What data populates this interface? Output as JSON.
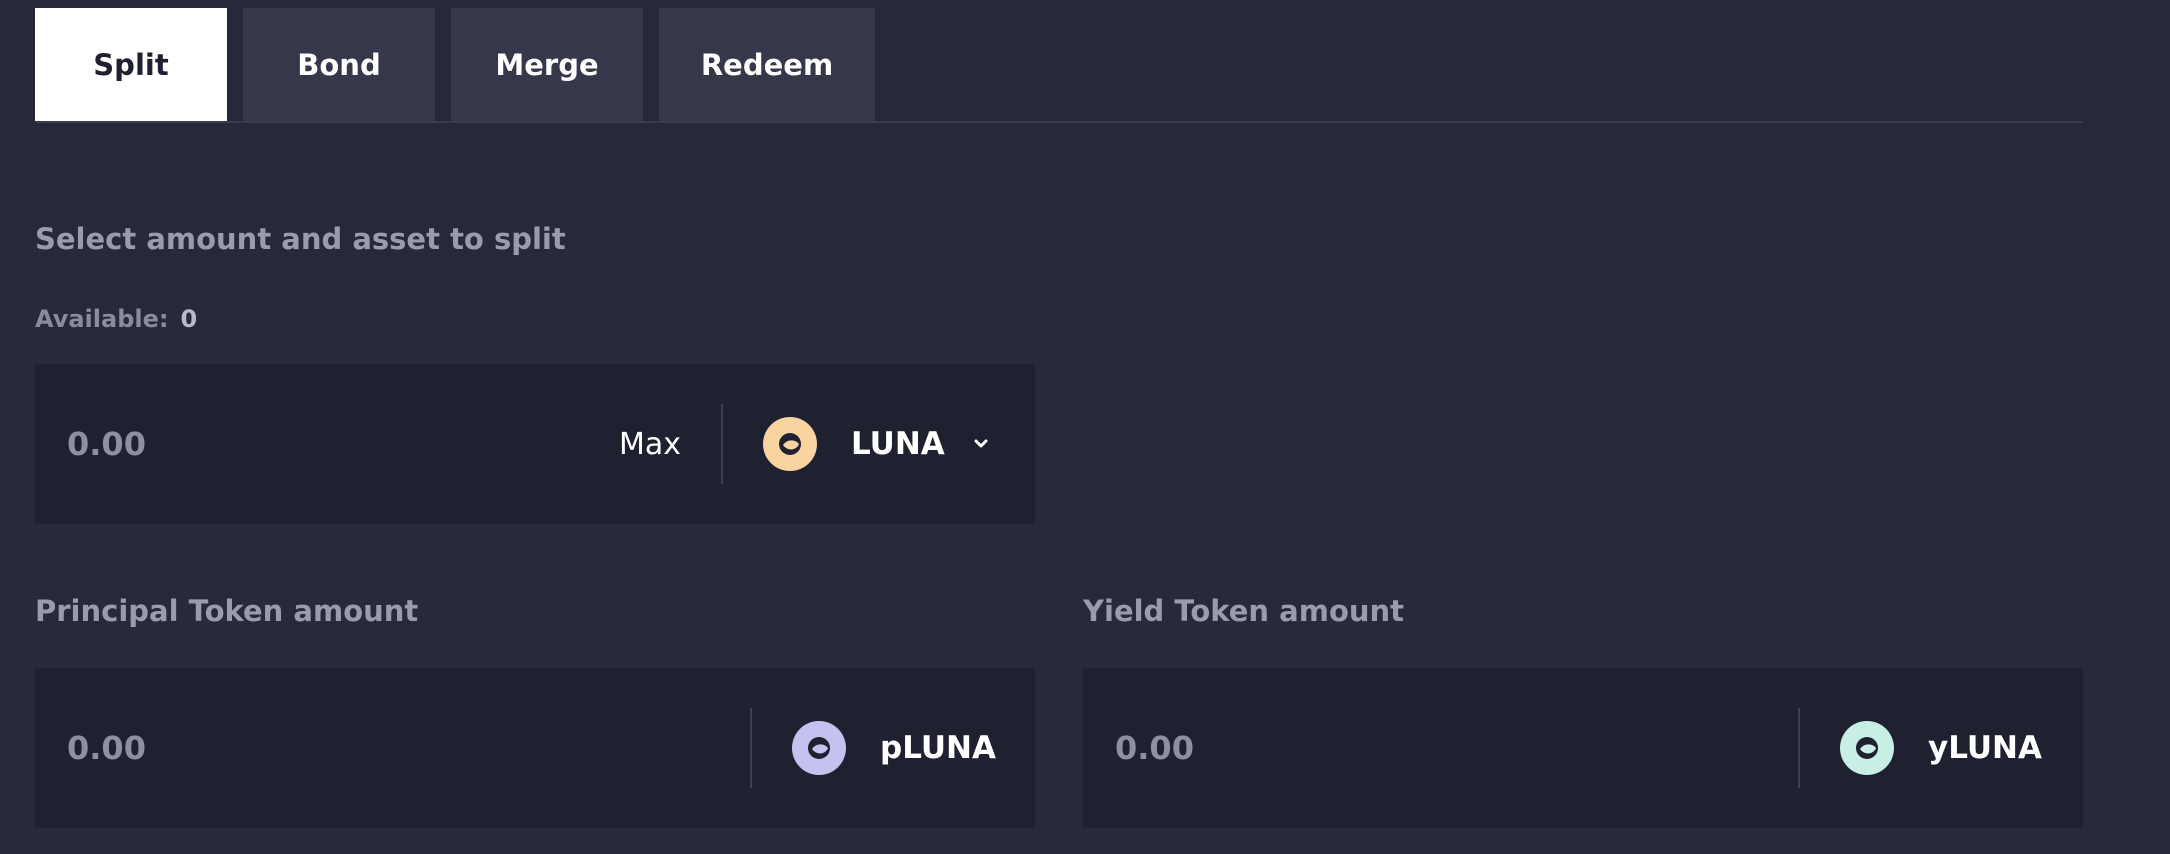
{
  "tabs": [
    {
      "label": "Split",
      "active": true
    },
    {
      "label": "Bond",
      "active": false
    },
    {
      "label": "Merge",
      "active": false
    },
    {
      "label": "Redeem",
      "active": false
    }
  ],
  "split": {
    "title": "Select amount and asset to split",
    "available_label": "Available:",
    "available_value": "0",
    "amount_value": "0.00",
    "max_label": "Max",
    "asset": {
      "name": "LUNA",
      "icon": "luna-icon",
      "color": "#f9d3a0"
    }
  },
  "principal": {
    "label": "Principal Token amount",
    "amount_value": "0.00",
    "token": {
      "name": "pLUNA",
      "icon": "pluna-icon",
      "color": "#c6c2ef"
    }
  },
  "yield": {
    "label": "Yield Token amount",
    "amount_value": "0.00",
    "token": {
      "name": "yLUNA",
      "icon": "yluna-icon",
      "color": "#c8eee6"
    }
  },
  "colors": {
    "background": "#272839",
    "panel": "#202130",
    "tab_inactive": "#36374a",
    "tab_active": "#ffffff"
  }
}
